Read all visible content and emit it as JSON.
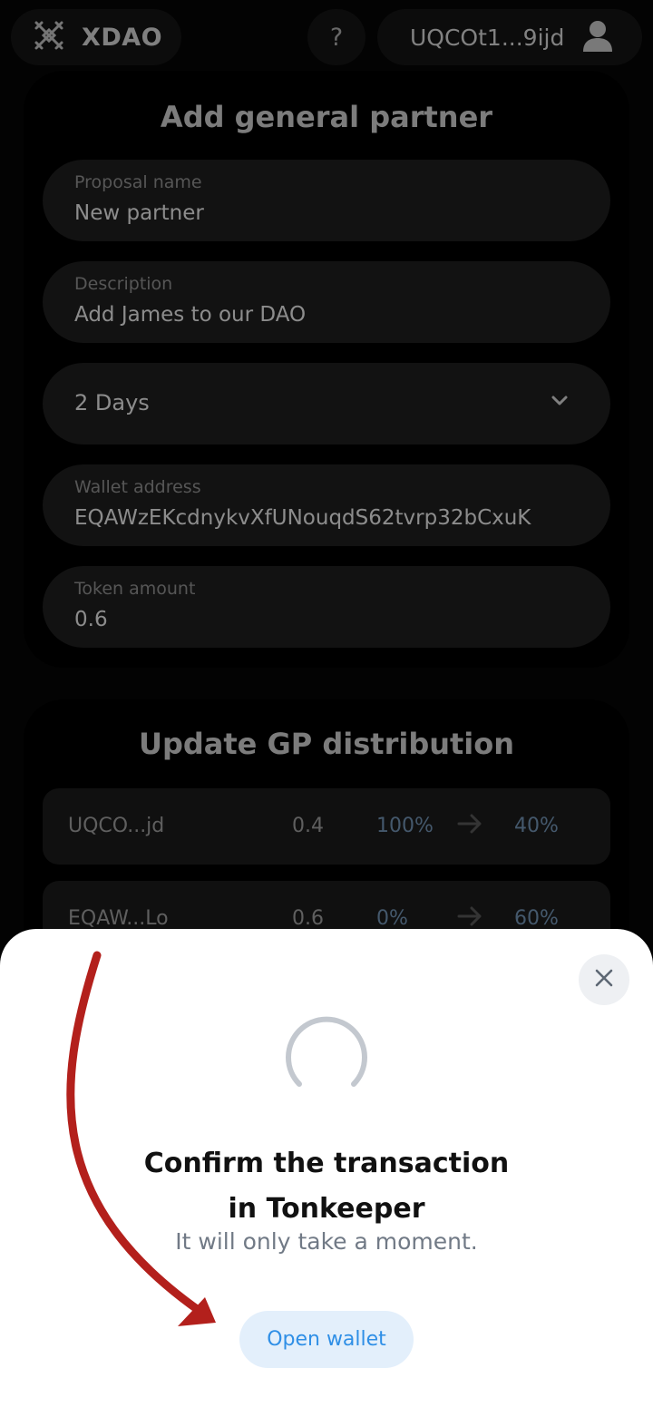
{
  "header": {
    "brand": "XDAO",
    "help_label": "?",
    "account_address": "UQCOt1...9ijd"
  },
  "add_partner": {
    "title": "Add general partner",
    "proposal_name": {
      "label": "Proposal name",
      "value": "New partner"
    },
    "description": {
      "label": "Description",
      "value": "Add James to our DAO"
    },
    "duration": {
      "value": "2 Days"
    },
    "wallet_address": {
      "label": "Wallet address",
      "value": "EQAWzEKcdnykvXfUNouqdS62tvrp32bCxuK"
    },
    "token_amount": {
      "label": "Token amount",
      "value": "0.6"
    }
  },
  "distribution": {
    "title": "Update GP distribution",
    "rows": [
      {
        "address": "UQCO...jd",
        "amount": "0.4",
        "from": "100%",
        "to": "40%"
      },
      {
        "address": "EQAW...Lo",
        "amount": "0.6",
        "from": "0%",
        "to": "60%"
      }
    ]
  },
  "modal": {
    "title_line1": "Confirm the transaction",
    "title_line2": "in Tonkeeper",
    "subtitle": "It will only take a moment.",
    "open_button": "Open wallet"
  },
  "colors": {
    "background": "#050505",
    "field": "#1d1d1d",
    "accent_blue": "#2f8fe6",
    "annotation_arrow": "#b3201c"
  }
}
